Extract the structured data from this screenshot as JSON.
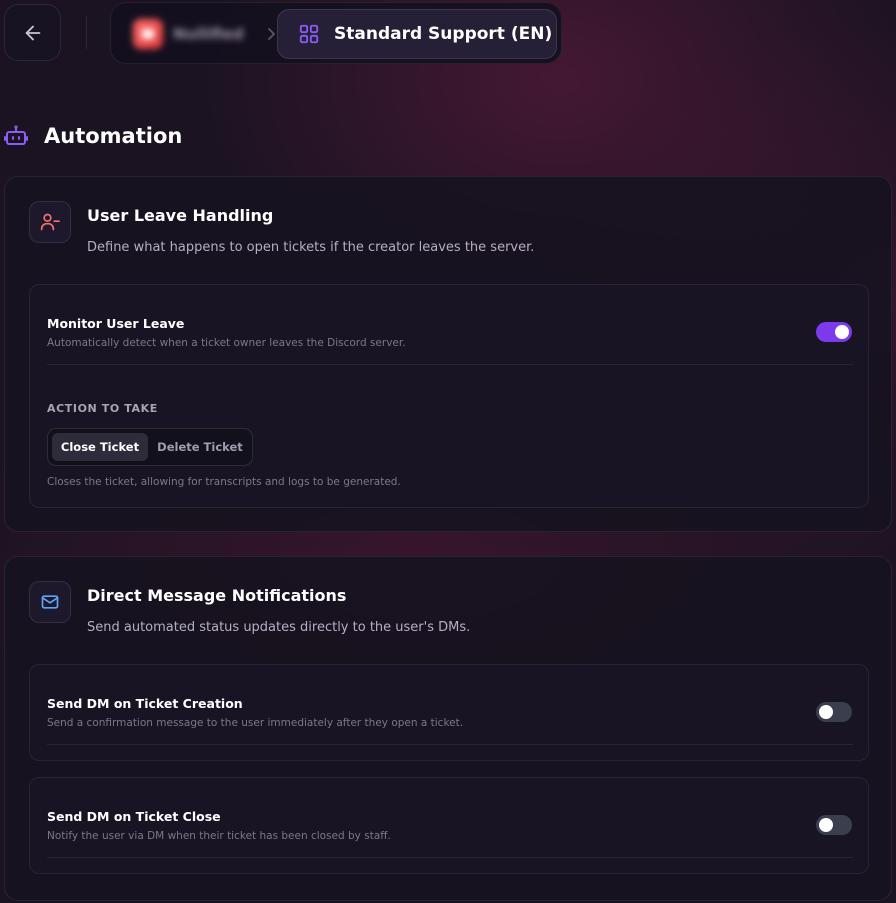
{
  "header": {
    "server_name": "Nullified",
    "current_page": "Standard Support (EN)"
  },
  "section": {
    "title": "Automation"
  },
  "user_leave": {
    "title": "User Leave Handling",
    "description": "Define what happens to open tickets if the creator leaves the server.",
    "monitor": {
      "label": "Monitor User Leave",
      "description": "Automatically detect when a ticket owner leaves the Discord server.",
      "enabled": true
    },
    "action_label": "ACTION TO TAKE",
    "actions": [
      "Close Ticket",
      "Delete Ticket"
    ],
    "selected_action": "Close Ticket",
    "action_description": "Closes the ticket, allowing for transcripts and logs to be generated."
  },
  "dm_notifications": {
    "title": "Direct Message Notifications",
    "description": "Send automated status updates directly to the user's DMs.",
    "on_create": {
      "label": "Send DM on Ticket Creation",
      "description": "Send a confirmation message to the user immediately after they open a ticket.",
      "enabled": false
    },
    "on_close": {
      "label": "Send DM on Ticket Close",
      "description": "Notify the user via DM when their ticket has been closed by staff.",
      "enabled": false
    }
  },
  "colors": {
    "accent": "#7c3aed",
    "toggle_off": "#3a3f4d",
    "leave_icon": "#f87171",
    "dm_icon": "#60a5fa",
    "bot_icon": "#8b5cf6"
  },
  "icons": {
    "back": "arrow-left-icon",
    "page": "grid-icon",
    "section": "bot-icon",
    "leave": "user-minus-icon",
    "dm": "mail-icon"
  }
}
